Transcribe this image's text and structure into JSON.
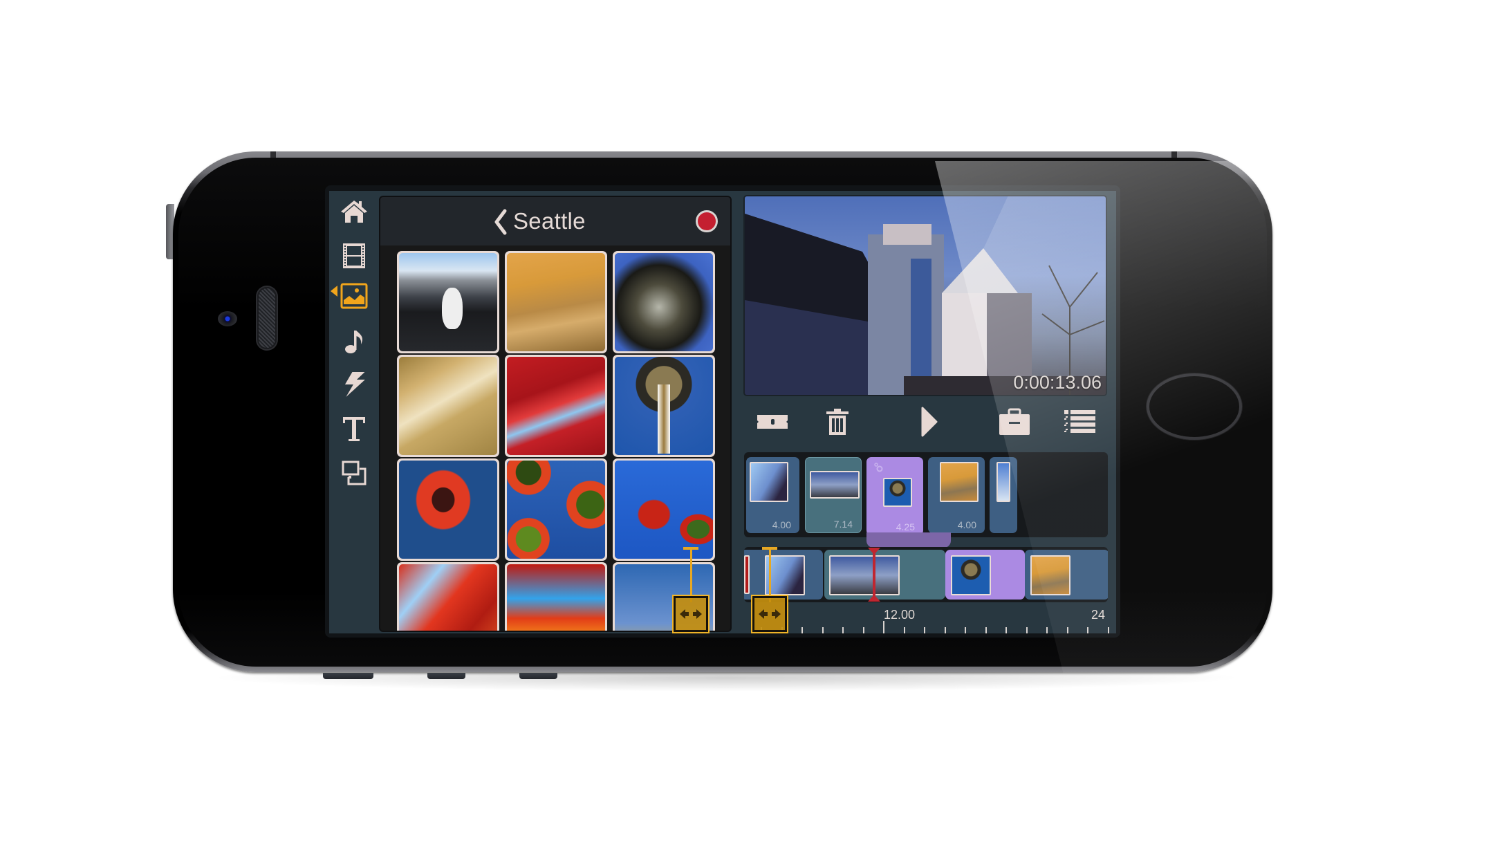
{
  "app": {
    "sidebar": {
      "items": [
        {
          "name": "home",
          "icon": "home-icon",
          "active": false
        },
        {
          "name": "video",
          "icon": "film-strip-icon",
          "active": false
        },
        {
          "name": "photos",
          "icon": "image-icon",
          "active": true
        },
        {
          "name": "music",
          "icon": "music-note-icon",
          "active": false
        },
        {
          "name": "effects",
          "icon": "lightning-icon",
          "active": false
        },
        {
          "name": "text",
          "icon": "text-icon",
          "active": false
        },
        {
          "name": "overlay",
          "icon": "overlay-layers-icon",
          "active": false
        }
      ],
      "accent_color": "#f1a51c"
    },
    "media_browser": {
      "back_icon": "chevron-left-icon",
      "title": "Seattle",
      "record_button_color": "#c41f30",
      "photos": [
        {
          "subject": "seagull at pier"
        },
        {
          "subject": "golden metal facade"
        },
        {
          "subject": "steel sculpture"
        },
        {
          "subject": "curved gold panels"
        },
        {
          "subject": "red sculpture"
        },
        {
          "subject": "space needle"
        },
        {
          "subject": "red sound garden flower"
        },
        {
          "subject": "space needle with sculptures"
        },
        {
          "subject": "red flower sculptures"
        },
        {
          "subject": "red ribbon sculpture"
        },
        {
          "subject": "red orange sculpture"
        },
        {
          "subject": "arches against sky"
        }
      ]
    },
    "preview": {
      "timecode": "0:00:13.06"
    },
    "toolbar": {
      "items": [
        {
          "name": "split",
          "icon": "razor-split-icon"
        },
        {
          "name": "delete",
          "icon": "trash-icon"
        },
        {
          "name": "play",
          "icon": "play-icon"
        },
        {
          "name": "toolbox",
          "icon": "toolbox-icon"
        },
        {
          "name": "track-list",
          "icon": "track-list-icon"
        }
      ]
    },
    "timeline_top": {
      "clips": [
        {
          "duration": "4.00",
          "selected": false,
          "type": "photo"
        },
        {
          "duration": "7.14",
          "selected": false,
          "type": "video"
        },
        {
          "duration": "4.25",
          "selected": true,
          "type": "photo",
          "has_settings": true
        },
        {
          "duration": "4.00",
          "selected": false,
          "type": "photo"
        },
        {
          "duration": "",
          "selected": false,
          "type": "photo"
        }
      ],
      "selected_color": "#ab8ae3"
    },
    "timeline_bottom": {
      "ruler_labels": [
        "12.00",
        "24"
      ]
    }
  }
}
